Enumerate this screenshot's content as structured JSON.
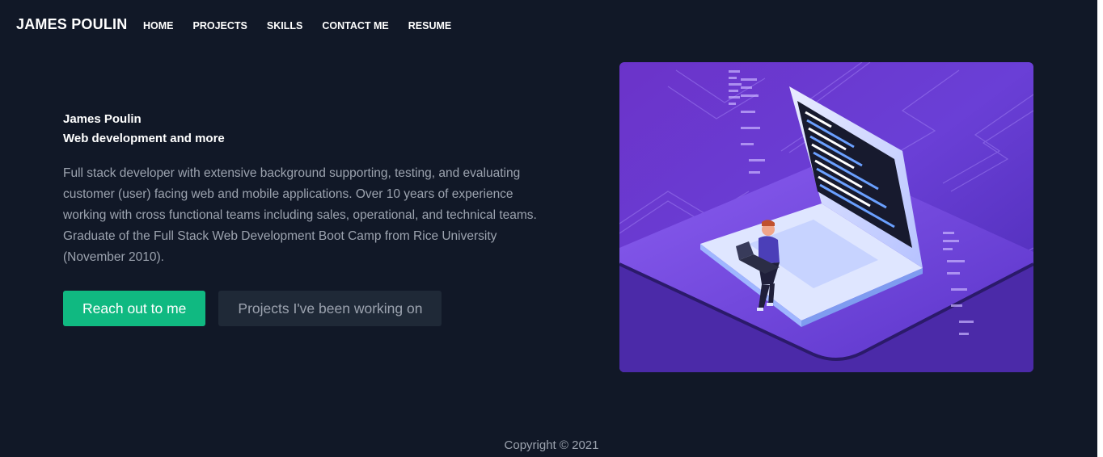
{
  "nav": {
    "brand": "JAMES POULIN",
    "links": [
      "HOME",
      "PROJECTS",
      "SKILLS",
      "CONTACT ME",
      "RESUME"
    ]
  },
  "hero": {
    "name": "James Poulin",
    "subtitle": "Web development and more",
    "description": "Full stack developer with extensive background supporting, testing, and evaluating customer (user) facing web and mobile applications. Over 10 years of experience working with cross functional teams including sales, operational, and technical teams. Graduate of the Full Stack Web Development Boot Camp from Rice University (November 2010).",
    "primary_button": "Reach out to me",
    "secondary_button": "Projects I've been working on",
    "illustration": "developer-with-laptop-illustration"
  },
  "footer": {
    "copyright": "Copyright © 2021"
  },
  "colors": {
    "background": "#111827",
    "accent": "#10b981",
    "secondary_button": "#1f2937",
    "illustration_purple": "#6d3fd0"
  }
}
